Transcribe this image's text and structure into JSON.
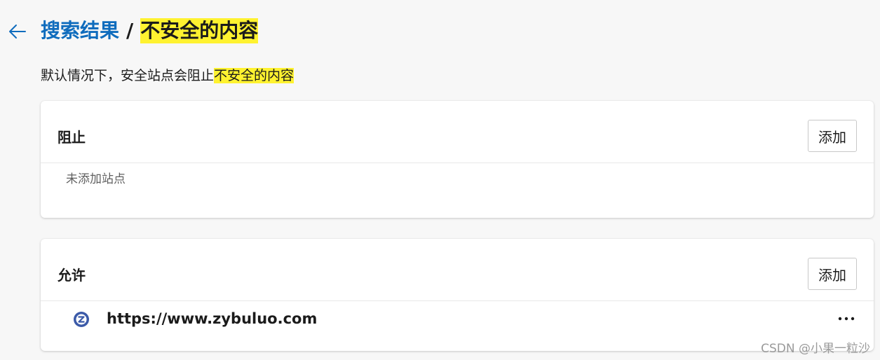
{
  "header": {
    "breadcrumb_parent": "搜索结果",
    "separator": "/",
    "current_page": "不安全的内容",
    "back_icon": "back-arrow-icon"
  },
  "description": {
    "prefix": "默认情况下，安全站点会阻止",
    "highlight": "不安全的内容"
  },
  "block_section": {
    "title": "阻止",
    "add_label": "添加",
    "empty_text": "未添加站点"
  },
  "allow_section": {
    "title": "允许",
    "add_label": "添加",
    "sites": [
      {
        "url": "https://www.zybuluo.com",
        "icon": "site-favicon-icon",
        "more_icon": "more-options-icon"
      }
    ]
  },
  "watermark": "CSDN @小果一粒沙",
  "colors": {
    "link": "#0f6cbd",
    "highlight": "#fff230",
    "background": "#f7f7f7",
    "card": "#ffffff"
  }
}
